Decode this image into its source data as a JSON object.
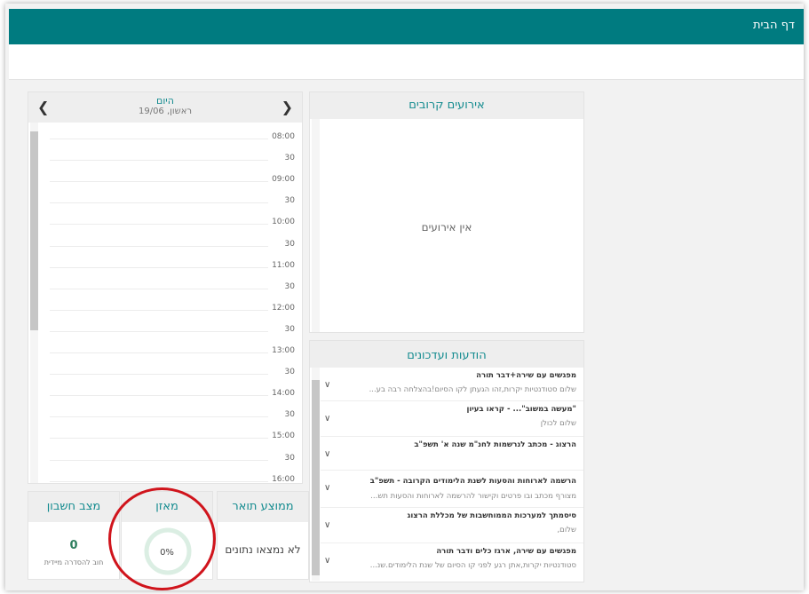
{
  "header": {
    "title": "דף הבית"
  },
  "calendar": {
    "title": "היום",
    "date": "ראשון, 19/06",
    "slots": [
      "08:00",
      "30",
      "09:00",
      "30",
      "10:00",
      "30",
      "11:00",
      "30",
      "12:00",
      "30",
      "13:00",
      "30",
      "14:00",
      "30",
      "15:00",
      "30",
      "16:00"
    ]
  },
  "events": {
    "title": "אירועים קרובים",
    "empty": "אין אירועים"
  },
  "messages": {
    "title": "הודעות ועדכונים",
    "items": [
      {
        "title": "מפגשים עם שירה+דבר תורה",
        "body": "שלום סטודנטיות יקרות,זהו הגעתן לקו הסיום!בהצלחה רבה בע..."
      },
      {
        "title": "\"מעשה במשוב\"... - קראו בעיון",
        "body": "שלום לכולן"
      },
      {
        "title": "הרצוג - מכתב לנרשמות לחנ\"מ שנה א' תשפ\"ב",
        "body": ""
      },
      {
        "title": "הרשמה לארוחות והסעות לשנת הלימודים הקרובה - תשפ\"ב",
        "body": "מצורף מכתב ובו פרטים וקישור להרשמה לארוחות והסעות תש..."
      },
      {
        "title": "סיסמתך למערכות הממוחשבות של מכללת הרצוג",
        "body": "שלום,"
      },
      {
        "title": "מפגשים עם שירה, ארגז כלים ודבר תורה",
        "body": "סטודנטיות יקרות,אתן רגע לפני קו הסיום של שנת הלימודים.שנ..."
      }
    ]
  },
  "cards": {
    "average": {
      "title": "ממוצע תואר",
      "value": "לא נמצאו נתונים"
    },
    "balance": {
      "title": "מאזן",
      "value": "0%",
      "progress": 0
    },
    "account": {
      "title": "מצב חשבון",
      "value": "0",
      "sub": "חוב להסדרה מיידית"
    }
  },
  "colors": {
    "topbar": "#007b80",
    "accent": "#138b8f",
    "highlight": "#d0141c"
  }
}
